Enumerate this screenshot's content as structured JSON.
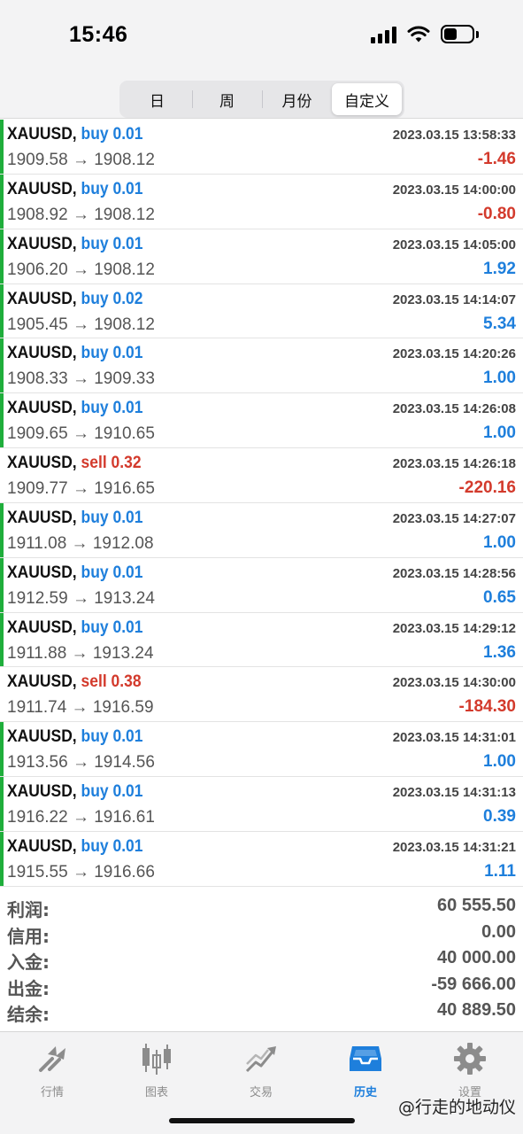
{
  "status_bar": {
    "time": "15:46"
  },
  "period_tabs": [
    {
      "label": "日",
      "active": false
    },
    {
      "label": "周",
      "active": false
    },
    {
      "label": "月份",
      "active": false
    },
    {
      "label": "自定义",
      "active": true
    }
  ],
  "deals": [
    {
      "symbol": "XAUUSD,",
      "direction": "buy",
      "volume": "0.01",
      "time": "2023.03.15 13:58:33",
      "prices": "1909.58 → 1908.12",
      "profit": "-1.46"
    },
    {
      "symbol": "XAUUSD,",
      "direction": "buy",
      "volume": "0.01",
      "time": "2023.03.15 14:00:00",
      "prices": "1908.92 → 1908.12",
      "profit": "-0.80"
    },
    {
      "symbol": "XAUUSD,",
      "direction": "buy",
      "volume": "0.01",
      "time": "2023.03.15 14:05:00",
      "prices": "1906.20 → 1908.12",
      "profit": "1.92"
    },
    {
      "symbol": "XAUUSD,",
      "direction": "buy",
      "volume": "0.02",
      "time": "2023.03.15 14:14:07",
      "prices": "1905.45 → 1908.12",
      "profit": "5.34"
    },
    {
      "symbol": "XAUUSD,",
      "direction": "buy",
      "volume": "0.01",
      "time": "2023.03.15 14:20:26",
      "prices": "1908.33 → 1909.33",
      "profit": "1.00"
    },
    {
      "symbol": "XAUUSD,",
      "direction": "buy",
      "volume": "0.01",
      "time": "2023.03.15 14:26:08",
      "prices": "1909.65 → 1910.65",
      "profit": "1.00"
    },
    {
      "symbol": "XAUUSD,",
      "direction": "sell",
      "volume": "0.32",
      "time": "2023.03.15 14:26:18",
      "prices": "1909.77 → 1916.65",
      "profit": "-220.16"
    },
    {
      "symbol": "XAUUSD,",
      "direction": "buy",
      "volume": "0.01",
      "time": "2023.03.15 14:27:07",
      "prices": "1911.08 → 1912.08",
      "profit": "1.00"
    },
    {
      "symbol": "XAUUSD,",
      "direction": "buy",
      "volume": "0.01",
      "time": "2023.03.15 14:28:56",
      "prices": "1912.59 → 1913.24",
      "profit": "0.65"
    },
    {
      "symbol": "XAUUSD,",
      "direction": "buy",
      "volume": "0.01",
      "time": "2023.03.15 14:29:12",
      "prices": "1911.88 → 1913.24",
      "profit": "1.36"
    },
    {
      "symbol": "XAUUSD,",
      "direction": "sell",
      "volume": "0.38",
      "time": "2023.03.15 14:30:00",
      "prices": "1911.74 → 1916.59",
      "profit": "-184.30"
    },
    {
      "symbol": "XAUUSD,",
      "direction": "buy",
      "volume": "0.01",
      "time": "2023.03.15 14:31:01",
      "prices": "1913.56 → 1914.56",
      "profit": "1.00"
    },
    {
      "symbol": "XAUUSD,",
      "direction": "buy",
      "volume": "0.01",
      "time": "2023.03.15 14:31:13",
      "prices": "1916.22 → 1916.61",
      "profit": "0.39"
    },
    {
      "symbol": "XAUUSD,",
      "direction": "buy",
      "volume": "0.01",
      "time": "2023.03.15 14:31:21",
      "prices": "1915.55 → 1916.66",
      "profit": "1.11"
    }
  ],
  "summary": [
    {
      "label": "利润:",
      "value": "60 555.50"
    },
    {
      "label": "信用:",
      "value": "0.00"
    },
    {
      "label": "入金:",
      "value": "40 000.00"
    },
    {
      "label": "出金:",
      "value": "-59 666.00"
    },
    {
      "label": "结余:",
      "value": "40 889.50"
    }
  ],
  "tab_bar": [
    {
      "label": "行情",
      "icon": "quotes-arrows-icon",
      "active": false
    },
    {
      "label": "图表",
      "icon": "candlestick-chart-icon",
      "active": false
    },
    {
      "label": "交易",
      "icon": "trade-trend-icon",
      "active": false
    },
    {
      "label": "历史",
      "icon": "history-inbox-icon",
      "active": true
    },
    {
      "label": "设置",
      "icon": "gear-icon",
      "active": false
    }
  ],
  "watermark": "@行走的地动仪",
  "colors": {
    "buy_blue": "#1e7fdc",
    "sell_red": "#d33a2c",
    "buy_marker_green": "#1fae3b",
    "inactive_gray": "#8c8c8c"
  }
}
